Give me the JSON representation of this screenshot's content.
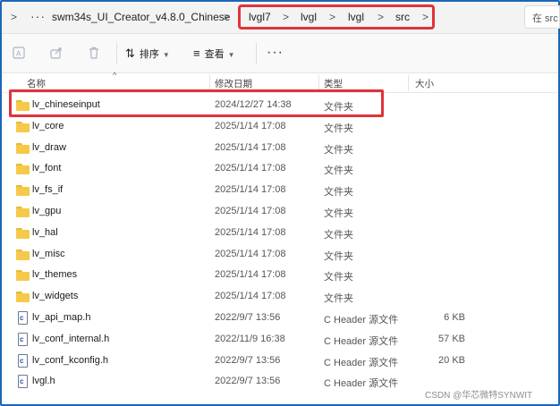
{
  "address_bar": {
    "overflow_label": "···",
    "crumbs": [
      "swm34s_UI_Creator_v4.8.0_Chinese",
      "lvgl7",
      "lvgl",
      "lvgl",
      "src"
    ],
    "search_placeholder": "在 src"
  },
  "toolbar": {
    "sort_label": "排序",
    "view_label": "查看",
    "more_label": "···"
  },
  "columns": {
    "name": "名称",
    "modified": "修改日期",
    "type": "类型",
    "size": "大小"
  },
  "files": [
    {
      "name": "lv_chineseinput",
      "date": "2024/12/27 14:38",
      "type": "文件夹",
      "size": "",
      "kind": "folder"
    },
    {
      "name": "lv_core",
      "date": "2025/1/14 17:08",
      "type": "文件夹",
      "size": "",
      "kind": "folder"
    },
    {
      "name": "lv_draw",
      "date": "2025/1/14 17:08",
      "type": "文件夹",
      "size": "",
      "kind": "folder"
    },
    {
      "name": "lv_font",
      "date": "2025/1/14 17:08",
      "type": "文件夹",
      "size": "",
      "kind": "folder"
    },
    {
      "name": "lv_fs_if",
      "date": "2025/1/14 17:08",
      "type": "文件夹",
      "size": "",
      "kind": "folder"
    },
    {
      "name": "lv_gpu",
      "date": "2025/1/14 17:08",
      "type": "文件夹",
      "size": "",
      "kind": "folder"
    },
    {
      "name": "lv_hal",
      "date": "2025/1/14 17:08",
      "type": "文件夹",
      "size": "",
      "kind": "folder"
    },
    {
      "name": "lv_misc",
      "date": "2025/1/14 17:08",
      "type": "文件夹",
      "size": "",
      "kind": "folder"
    },
    {
      "name": "lv_themes",
      "date": "2025/1/14 17:08",
      "type": "文件夹",
      "size": "",
      "kind": "folder"
    },
    {
      "name": "lv_widgets",
      "date": "2025/1/14 17:08",
      "type": "文件夹",
      "size": "",
      "kind": "folder"
    },
    {
      "name": "lv_api_map.h",
      "date": "2022/9/7 13:56",
      "type": "C Header 源文件",
      "size": "6 KB",
      "kind": "header"
    },
    {
      "name": "lv_conf_internal.h",
      "date": "2022/11/9 16:38",
      "type": "C Header 源文件",
      "size": "57 KB",
      "kind": "header"
    },
    {
      "name": "lv_conf_kconfig.h",
      "date": "2022/9/7 13:56",
      "type": "C Header 源文件",
      "size": "20 KB",
      "kind": "header"
    },
    {
      "name": "lvgl.h",
      "date": "2022/9/7 13:56",
      "type": "C Header 源文件",
      "size": "",
      "kind": "header"
    }
  ],
  "watermark": "CSDN @华芯微特SYNWIT",
  "colors": {
    "highlight": "#e0333a",
    "folder": "#f6c94a",
    "frame": "#1c66b8"
  }
}
